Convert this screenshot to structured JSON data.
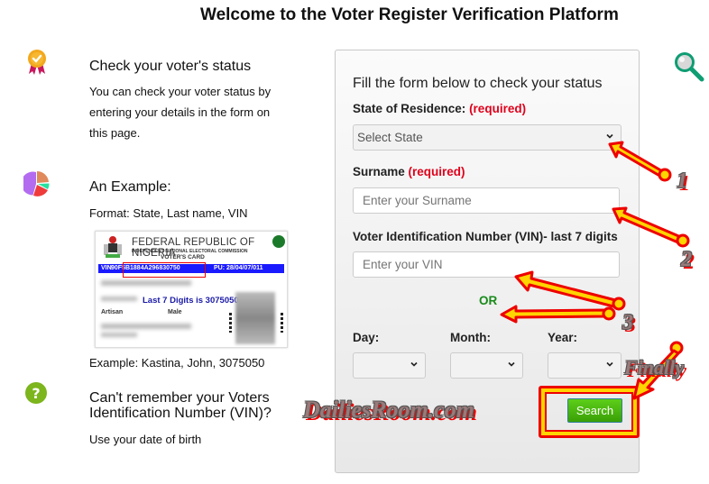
{
  "page": {
    "title": "Welcome to the Voter Register Verification Platform"
  },
  "info": {
    "check_status": {
      "icon": "award-badge-icon",
      "title": "Check your voter's status",
      "text_lines": [
        "You can check your voter status by",
        "entering your details in the form on",
        "this page."
      ]
    },
    "example": {
      "icon": "pie-chart-icon",
      "title": "An Example:",
      "format": "Format: State, Last name, VIN",
      "example_text": "Example: Kastina, John, 3075050",
      "card": {
        "country": "FEDERAL REPUBLIC OF NIGERIA",
        "commission": "INDEPENDENT NATIONAL ELECTORAL COMMISSION",
        "card_type": "VOTER'S CARD",
        "vin_label": "VIN",
        "vin": "90F5B1884A296830750",
        "pu": "PU: 28/04/07/011",
        "annotation": "Last 7 Digits is 3075050",
        "occupation": "Artisan",
        "sex": "Male"
      }
    },
    "forgot_vin": {
      "icon": "question-circle-icon",
      "title_lines": [
        "Can't remember your Voters",
        "Identification Number (VIN)?"
      ],
      "text": "Use your date of birth"
    }
  },
  "form": {
    "heading": "Fill the form below to check your status",
    "state": {
      "label": "State of Residence:",
      "required": "(required)",
      "value": "Select State"
    },
    "surname": {
      "label": "Surname",
      "required": "(required)",
      "placeholder": "Enter your Surname",
      "value": ""
    },
    "vin": {
      "label": "Voter Identification Number (VIN)- last 7 digits",
      "placeholder": "Enter your VIN",
      "value": ""
    },
    "or_text": "OR",
    "day": {
      "label": "Day:",
      "value": ""
    },
    "month": {
      "label": "Month:",
      "value": ""
    },
    "year": {
      "label": "Year:",
      "value": ""
    },
    "search_label": "Search"
  },
  "annotations": {
    "step1": "1",
    "step2": "2",
    "step3": "3",
    "finally": "Finally",
    "watermark": "DailiesRoom.com"
  },
  "colors": {
    "required": "#e0001b",
    "or": "#1a8a1a",
    "search_button": "#4cb812",
    "arrow_fill": "#ffd400",
    "arrow_stroke": "#ee0000",
    "search_icon": "#0f9d73"
  }
}
